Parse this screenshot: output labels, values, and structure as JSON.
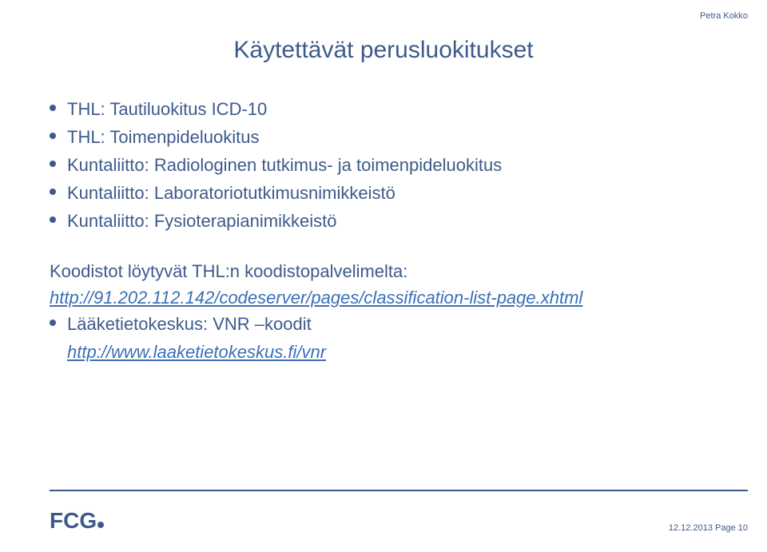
{
  "author": "Petra Kokko",
  "title": "Käytettävät perusluokitukset",
  "bullets_a": [
    "THL: Tautiluokitus ICD-10",
    "THL: Toimenpideluokitus",
    "Kuntaliitto: Radiologinen tutkimus- ja toimenpideluokitus",
    "Kuntaliitto: Laboratoriotutkimusnimikkeistö",
    "Kuntaliitto: Fysioterapianimikkeistö"
  ],
  "paragraph": "Koodistot löytyvät THL:n koodistopalvelimelta:",
  "link_a": "http://91.202.112.142/codeserver/pages/classification-list-page.xhtml",
  "bullet_b_label": "Lääketietokeskus: VNR –koodit",
  "link_b": "http://www.laaketietokeskus.fi/vnr",
  "footer": {
    "date": "12.12.2013",
    "page": "Page 10"
  },
  "logo_text": "FCG"
}
